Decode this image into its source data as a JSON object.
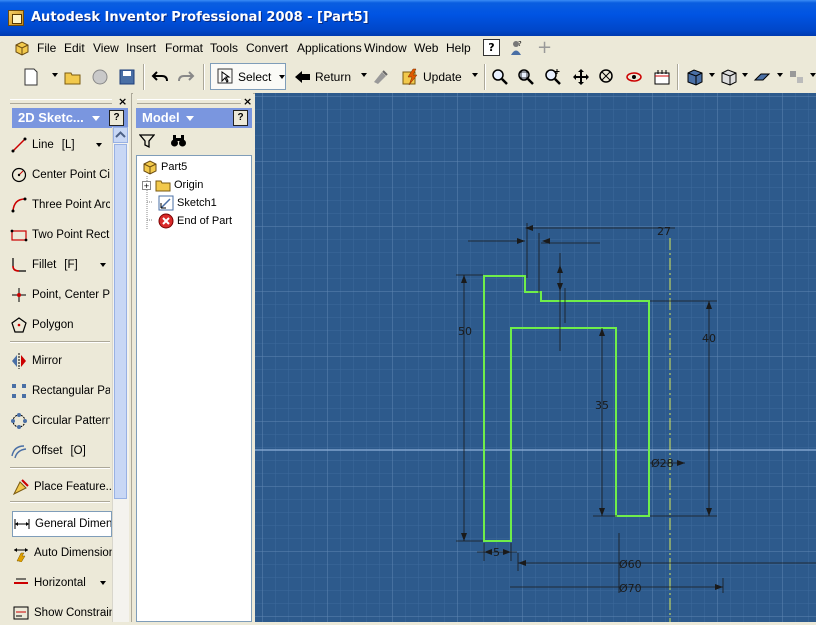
{
  "window": {
    "title": "Autodesk Inventor Professional 2008 - [Part5]"
  },
  "menu": {
    "items": [
      "File",
      "Edit",
      "View",
      "Insert",
      "Format",
      "Tools",
      "Convert",
      "Applications",
      "Window",
      "Web",
      "Help"
    ]
  },
  "toolbar": {
    "select_label": "Select",
    "return_label": "Return",
    "update_label": "Update"
  },
  "sketch_panel": {
    "title": "2D Sketc...",
    "tools": [
      {
        "label": "Line",
        "shortcut": "[L]",
        "icon": "line-icon",
        "has_dropdown": true
      },
      {
        "label": "Center Point Ci",
        "shortcut": "",
        "icon": "circle-icon"
      },
      {
        "label": "Three Point Arc",
        "shortcut": "",
        "icon": "arc-icon"
      },
      {
        "label": "Two Point Rect",
        "shortcut": "",
        "icon": "rectangle-icon"
      },
      {
        "label": "Fillet",
        "shortcut": "[F]",
        "icon": "fillet-icon",
        "has_dropdown": true
      },
      {
        "label": "Point, Center Po",
        "shortcut": "",
        "icon": "point-icon"
      },
      {
        "label": "Polygon",
        "shortcut": "",
        "icon": "polygon-icon"
      },
      {
        "label": "Mirror",
        "shortcut": "",
        "icon": "mirror-icon"
      },
      {
        "label": "Rectangular Pat",
        "shortcut": "",
        "icon": "rectangular-pattern-icon"
      },
      {
        "label": "Circular Pattern",
        "shortcut": "",
        "icon": "circular-pattern-icon"
      },
      {
        "label": "Offset",
        "shortcut": "[O]",
        "icon": "offset-icon"
      },
      {
        "label": "Place Feature...",
        "shortcut": "",
        "icon": "place-feature-icon"
      },
      {
        "label": "General Dimensi",
        "shortcut": "",
        "icon": "general-dimension-icon"
      },
      {
        "label": "Auto Dimension",
        "shortcut": "",
        "icon": "auto-dimension-icon"
      },
      {
        "label": "Horizontal",
        "shortcut": "",
        "icon": "horizontal-constraint-icon",
        "has_dropdown": true
      },
      {
        "label": "Show Constraint",
        "shortcut": "",
        "icon": "show-constraints-icon"
      }
    ]
  },
  "model_panel": {
    "title": "Model",
    "tree": [
      {
        "label": "Part5",
        "icon": "part-icon"
      },
      {
        "label": "Origin",
        "icon": "folder-icon"
      },
      {
        "label": "Sketch1",
        "icon": "sketch-icon"
      },
      {
        "label": "End of Part",
        "icon": "end-of-part-icon"
      }
    ]
  },
  "sketch": {
    "dimensions": [
      {
        "label": "27",
        "text": "27"
      },
      {
        "label": "50-left",
        "text": "50"
      },
      {
        "label": "40-right",
        "text": "40"
      },
      {
        "label": "35",
        "text": "35"
      },
      {
        "label": "diameter-28",
        "text": "Ø28"
      },
      {
        "label": "5-bottom",
        "text": "5"
      },
      {
        "label": "diameter-60",
        "text": "Ø60"
      },
      {
        "label": "diameter-70",
        "text": "Ø70"
      }
    ],
    "colors": {
      "background": "#2d5a8c",
      "grid_major": "#5f86b2",
      "grid_minor": "#3d6a9c",
      "profile": "#6fee4a",
      "dimension": "#1a1a1a",
      "centerline": "#d8e85a"
    }
  }
}
